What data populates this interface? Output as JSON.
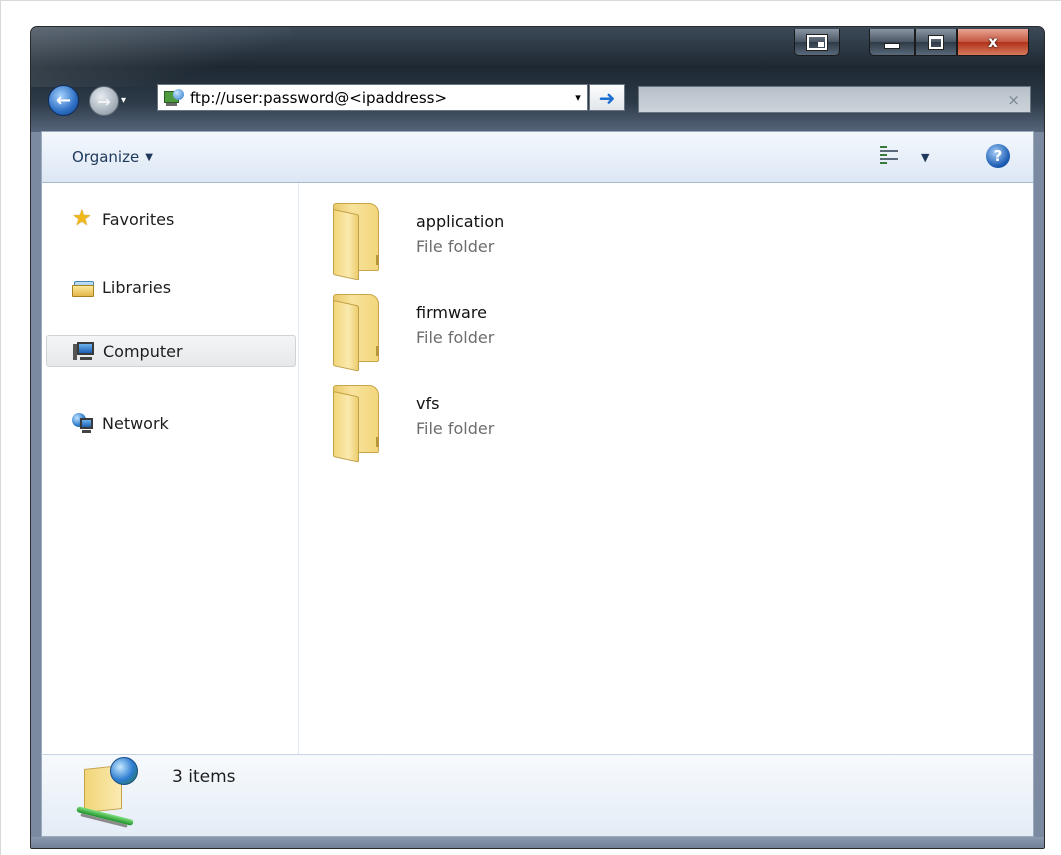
{
  "titlebar": {
    "close_glyph": "x"
  },
  "nav": {
    "back_glyph": "←",
    "forward_glyph": "→",
    "history_dropdown_glyph": "▾"
  },
  "address_bar": {
    "value": "ftp://user:password@<ipaddress>",
    "dropdown_glyph": "▾",
    "go_glyph": "➜"
  },
  "search": {
    "value": "",
    "clear_glyph": "×"
  },
  "command_bar": {
    "organize_label": "Organize",
    "organize_arrow": "▼",
    "view_dropdown": "▼",
    "help_glyph": "?"
  },
  "navigation_pane": {
    "items": [
      {
        "label": "Favorites",
        "icon": "star-icon"
      },
      {
        "label": "Libraries",
        "icon": "libraries-icon"
      },
      {
        "label": "Computer",
        "icon": "computer-icon",
        "selected": true
      },
      {
        "label": "Network",
        "icon": "network-icon"
      }
    ]
  },
  "files": [
    {
      "name": "application",
      "type": "File folder"
    },
    {
      "name": "firmware",
      "type": "File folder"
    },
    {
      "name": "vfs",
      "type": "File folder"
    }
  ],
  "details_pane": {
    "item_count": "3 items"
  },
  "colors": {
    "accent": "#1d6fd1",
    "close_button": "#c4563f",
    "folder": "#f3d67c"
  }
}
